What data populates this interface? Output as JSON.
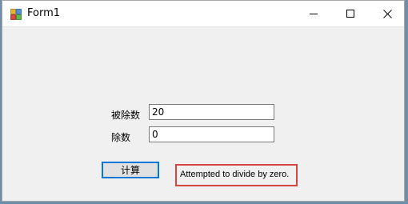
{
  "window": {
    "title": "Form1",
    "icon": "winforms-app-icon",
    "controls": {
      "minimize_icon": "minimize-icon",
      "maximize_icon": "maximize-icon",
      "close_icon": "close-icon"
    }
  },
  "form": {
    "dividend_label": "被除数",
    "dividend_value": "20",
    "divisor_label": "除数",
    "divisor_value": "0",
    "calculate_button": "计算",
    "result_text": "Attempted to divide by zero."
  },
  "colors": {
    "highlight_border": "#d6453f",
    "focus_border": "#0078d7"
  }
}
